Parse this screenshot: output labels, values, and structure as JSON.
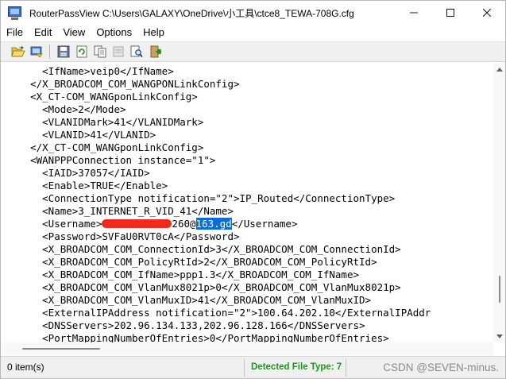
{
  "window": {
    "title": "RouterPassView    C:\\Users\\GALAXY\\OneDrive\\小工具\\ctce8_TEWA-708G.cfg",
    "controls": {
      "minimize": "minimize-icon",
      "maximize": "maximize-icon",
      "close": "close-icon"
    }
  },
  "menu": [
    "File",
    "Edit",
    "View",
    "Options",
    "Help"
  ],
  "toolbar": {
    "buttons": [
      "open-folder-icon",
      "open-router-icon",
      "save-icon",
      "refresh-icon",
      "copy-icon",
      "properties-icon",
      "find-icon",
      "exit-icon"
    ]
  },
  "lines": [
    {
      "text": "      <IfName>veip0</IfName>"
    },
    {
      "text": "    </X_BROADCOM_COM_WANGPONLinkConfig>"
    },
    {
      "text": "    <X_CT-COM_WANGponLinkConfig>"
    },
    {
      "text": "      <Mode>2</Mode>"
    },
    {
      "text": "      <VLANIDMark>41</VLANIDMark>"
    },
    {
      "text": "      <VLANID>41</VLANID>"
    },
    {
      "text": "    </X_CT-COM_WANGponLinkConfig>"
    },
    {
      "text": "    <WANPPPConnection instance=\"1\">"
    },
    {
      "text": "      <IAID>37057</IAID>"
    },
    {
      "text": "      <Enable>TRUE</Enable>"
    },
    {
      "text": "      <ConnectionType notification=\"2\">IP_Routed</ConnectionType>"
    },
    {
      "text": "      <Name>3_INTERNET_R_VID_41</Name>"
    },
    {
      "username": true,
      "prefix": "      <Username>",
      "visible_part": "260@",
      "selected": "163.gd",
      "suffix": "</Username>"
    },
    {
      "text": "      <Password>SVFaU0RVT0cA</Password>"
    },
    {
      "text": "      <X_BROADCOM_COM_ConnectionId>3</X_BROADCOM_COM_ConnectionId>"
    },
    {
      "text": "      <X_BROADCOM_COM_PolicyRtId>2</X_BROADCOM_COM_PolicyRtId>"
    },
    {
      "text": "      <X_BROADCOM_COM_IfName>ppp1.3</X_BROADCOM_COM_IfName>"
    },
    {
      "text": "      <X_BROADCOM_COM_VlanMux8021p>0</X_BROADCOM_COM_VlanMux8021p>"
    },
    {
      "text": "      <X_BROADCOM_COM_VlanMuxID>41</X_BROADCOM_COM_VlanMuxID>"
    },
    {
      "text": "      <ExternalIPAddress notification=\"2\">100.64.202.10</ExternalIPAddr"
    },
    {
      "text": "      <DNSServers>202.96.134.133,202.96.128.166</DNSServers>"
    },
    {
      "text": "      <PortMappingNumberOfEntries>0</PortMappingNumberOfEntries>"
    }
  ],
  "status": {
    "items": "0 item(s)",
    "file_type": "Detected File Type: 7"
  },
  "watermark": "CSDN @SEVEN-minus.",
  "colors": {
    "selection": "#0a6cd6",
    "redaction": "#f2291c",
    "status_green": "#1a9a1a"
  }
}
